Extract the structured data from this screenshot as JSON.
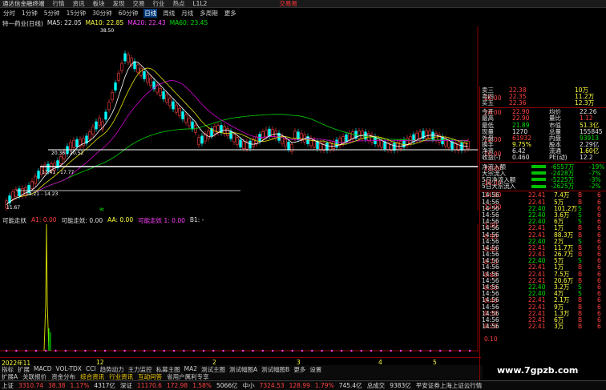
{
  "menubar": {
    "app_title": "通达信金融终端",
    "items": [
      "行情",
      "资讯",
      "板块",
      "发现",
      "交易",
      "行业",
      "热点"
    ],
    "version": "L1L2",
    "trade_label": "交易易"
  },
  "toolbar": {
    "periods": [
      "分时",
      "1分钟",
      "5分钟",
      "15分钟",
      "30分钟",
      "60分钟",
      "日线",
      "周线",
      "月线",
      "多周期",
      "更多"
    ],
    "active": "日线"
  },
  "legend": {
    "stock": "特一药业(日线)",
    "ma5": "MA5: 22.05",
    "ma10": "MA10: 22.85",
    "ma20": "MA20: 22.43",
    "ma60": "MA60: 23.45"
  },
  "colors": {
    "up": "#ff4040",
    "down": "#00ffff",
    "ma5": "#ffffff",
    "ma10": "#ffff00",
    "ma20": "#ff00ff",
    "ma60": "#00ff00",
    "grid": "#8b0000"
  },
  "annotations": {
    "high": "38.50",
    "low": "11.67",
    "lvl1": "20.36 - 20.52",
    "lvl2": "17.41 - 17.77",
    "lvl3": "14.21 - 14.23",
    "marker1": "跌",
    "marker2": "赤",
    "marker3": "E跌"
  },
  "yaxis": {
    "main": [
      "26.00",
      "24.00",
      "22.00",
      "20.00",
      "18.00",
      "16.00",
      "14.00",
      "12.00"
    ],
    "sub": [
      "1.00",
      "0.90",
      "0.80",
      "0.70",
      "0.60",
      "0.50",
      "0.40",
      "0.30",
      "0.20",
      "0.10"
    ]
  },
  "subhead": {
    "name": "可能走妖",
    "a1": "A1: 0.00",
    "v": "可能走妖: 0.00",
    "aa": "AA: 0.00",
    "v2": "可能走妖 1: 0.00",
    "b1": "B1: -",
    "b2": "ZXG: 0.00"
  },
  "datebar": {
    "labels": [
      "2022年11",
      "12",
      "2",
      "3",
      "4",
      "5",
      "6"
    ]
  },
  "tabs": [
    "指标",
    "扩展",
    "MACD",
    "VOL-TDX",
    "CCI",
    "趋势动力",
    "主力监控",
    "私募主图",
    "MA2",
    "测试主图",
    "测试幅图A",
    "测试幅图B",
    "更多",
    "设置"
  ],
  "tabs2": [
    "扩展A",
    "关联报价",
    "资金分布",
    "综合资讯",
    "行业资讯",
    "互动问答",
    "省用户属利专享"
  ],
  "tabs2_hl": [
    "综合资讯",
    "行业资讯",
    "互动问答"
  ],
  "quote": {
    "sell": [
      {
        "l": "卖三",
        "p": "22.38",
        "v": "10万"
      },
      {
        "l": "卖四",
        "p": "22.35",
        "v": "11.2万"
      },
      {
        "l": "买五",
        "p": "22.36",
        "v": "12.3万"
      }
    ],
    "stats": [
      {
        "l1": "今开",
        "v1": "22.90",
        "l2": "均价",
        "v2": "22.26"
      },
      {
        "l1": "最高",
        "v1": "22.90",
        "l2": "量比",
        "v2": "1.12"
      },
      {
        "l1": "最低",
        "v1": "21.89",
        "l2": "市值",
        "v2": "51.3亿"
      },
      {
        "l1": "现量",
        "v1": "1270",
        "l2": "总量",
        "v2": "155845"
      },
      {
        "l1": "外盘",
        "v1": "61932",
        "l2": "内盘",
        "v2": "93913"
      },
      {
        "l1": "换手",
        "v1": "9.75%",
        "l2": "股本",
        "v2": "2.29亿"
      },
      {
        "l1": "净资",
        "v1": "6.42",
        "l2": "流通",
        "v2": "1.60亿"
      },
      {
        "l1": "收益(-)",
        "v1": "0.460",
        "l2": "PE(动)",
        "v2": "12.2"
      }
    ],
    "flows": [
      {
        "l": "净流入额",
        "v": "-6557万",
        "p": "-19%"
      },
      {
        "l": "大宗流入",
        "v": "-2428万",
        "p": "-7%"
      },
      {
        "l": "5日净流入额",
        "v": "-5225万",
        "p": "-3%"
      },
      {
        "l": "5日大宗流入",
        "v": "-2625万",
        "p": "-2%"
      }
    ],
    "ticks": [
      {
        "t": "14:56",
        "p": "22.41",
        "v": "7.4万",
        "d": "B"
      },
      {
        "t": "14:56",
        "p": "22.41",
        "v": "5万",
        "d": "B"
      },
      {
        "t": "14:56",
        "p": "22.40",
        "v": "101.2万",
        "d": "S"
      },
      {
        "t": "14:56",
        "p": "22.40",
        "v": "3.6万",
        "d": "S"
      },
      {
        "t": "14:56",
        "p": "22.40",
        "v": "6万",
        "d": "S"
      },
      {
        "t": "14:56",
        "p": "22.41",
        "v": "1万",
        "d": "B"
      },
      {
        "t": "14:56",
        "p": "22.41",
        "v": "88.3万",
        "d": "B"
      },
      {
        "t": "14:56",
        "p": "22.40",
        "v": "2万",
        "d": "S"
      },
      {
        "t": "14:56",
        "p": "22.41",
        "v": "11.7万",
        "d": "B"
      },
      {
        "t": "14:56",
        "p": "22.41",
        "v": "26.7万",
        "d": "B"
      },
      {
        "t": "14:56",
        "p": "22.40",
        "v": "5万",
        "d": "S"
      },
      {
        "t": "14:56",
        "p": "22.41",
        "v": "1万",
        "d": "B"
      },
      {
        "t": "14:56",
        "p": "22.41",
        "v": "7.5万",
        "d": "B"
      },
      {
        "t": "14:56",
        "p": "22.41",
        "v": "20.6万",
        "d": "B"
      },
      {
        "t": "14:56",
        "p": "22.40",
        "v": "3.2万",
        "d": "S"
      },
      {
        "t": "14:56",
        "p": "22.40",
        "v": "4万",
        "d": "S"
      },
      {
        "t": "14:56",
        "p": "22.41",
        "v": "2.1万",
        "d": "B"
      },
      {
        "t": "14:56",
        "p": "22.41",
        "v": "9万",
        "d": "B"
      },
      {
        "t": "14:56",
        "p": "22.41",
        "v": "1.3万",
        "d": "B"
      },
      {
        "t": "14:56",
        "p": "22.41",
        "v": "6万",
        "d": "B"
      },
      {
        "t": "14:56",
        "p": "22.41",
        "v": "3万",
        "d": "B"
      }
    ]
  },
  "statusbar": {
    "sh": "上证",
    "sh_v": "3310.74",
    "sh_c": "38.38",
    "sh_p": "1.17%",
    "sh_a": "4317亿",
    "sz": "深证",
    "sz_v": "11170.6",
    "sz_c": "172.98",
    "sz_p": "1.58%",
    "sz_a": "5066亿",
    "zx": "中小",
    "zx_v": "7324.53",
    "zx_c": "128.99",
    "zx_p": "1.79%",
    "zx_a": "745.4亿",
    "total": "总成交",
    "total_v": "9383亿",
    "info": "平安证券上海上证云行情"
  },
  "watermark": "www.7gpzb.com"
}
